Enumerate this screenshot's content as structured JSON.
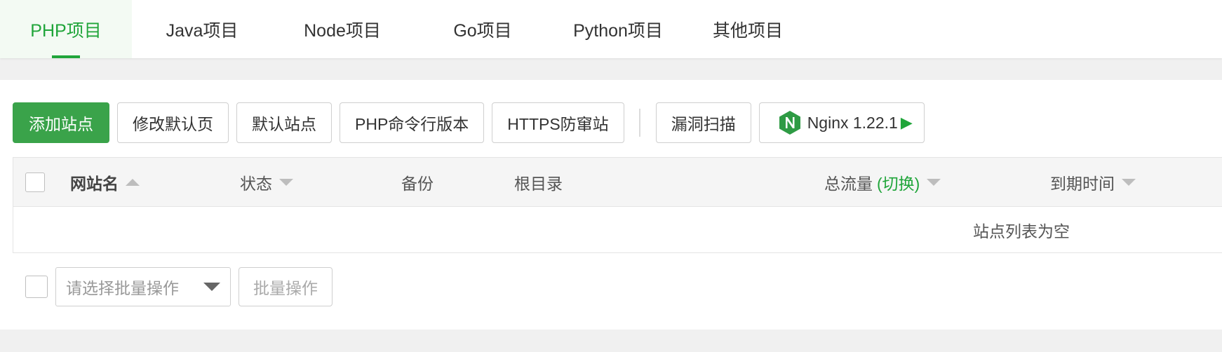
{
  "tabs": [
    {
      "label": "PHP项目",
      "active": true
    },
    {
      "label": "Java项目"
    },
    {
      "label": "Node项目"
    },
    {
      "label": "Go项目"
    },
    {
      "label": "Python项目"
    },
    {
      "label": "其他项目"
    }
  ],
  "toolbar": {
    "add_site": "添加站点",
    "modify_default_page": "修改默认页",
    "default_site": "默认站点",
    "php_cli_version": "PHP命令行版本",
    "https_protection": "HTTPS防窜站",
    "vuln_scan": "漏洞扫描",
    "nginx_label": "Nginx 1.22.1",
    "nginx_icon": "nginx-icon"
  },
  "table": {
    "columns": {
      "site_name": "网站名",
      "status": "状态",
      "backup": "备份",
      "root_dir": "根目录",
      "total_traffic": "总流量",
      "switch": "(切换)",
      "expire_time": "到期时间"
    },
    "empty_text": "站点列表为空"
  },
  "batch": {
    "select_placeholder": "请选择批量操作",
    "button": "批量操作"
  },
  "colors": {
    "accent": "#20a53a",
    "primary_button": "#3aa34a"
  }
}
